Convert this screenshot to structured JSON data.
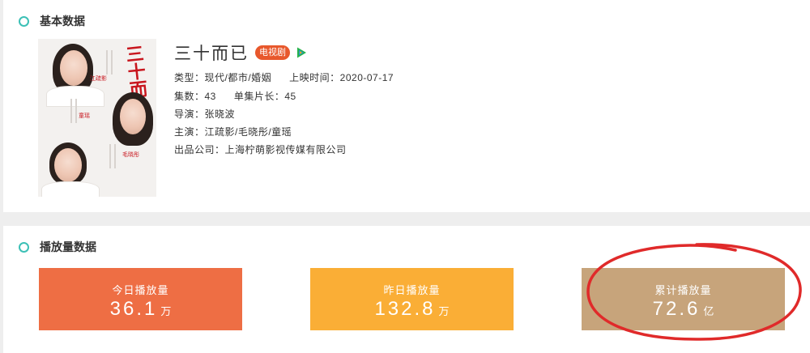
{
  "basic": {
    "section_title": "基本数据",
    "title": "三十而已",
    "badge": "电视剧",
    "genre": "类型：现代/都市/婚姻",
    "release": "上映时间：2020-07-17",
    "episodes": "集数：43",
    "duration": "单集片长：45",
    "director": "导演：张晓波",
    "cast": "主演：江疏影/毛晓彤/童瑶",
    "company": "出品公司：上海柠萌影视传媒有限公司",
    "poster_text": "三十而已",
    "poster_names": [
      "江疏影",
      "童瑶",
      "毛晓彤"
    ]
  },
  "play": {
    "section_title": "播放量数据",
    "stats": [
      {
        "label": "今日播放量",
        "value": "36.1",
        "unit": "万",
        "color": "#ee6e44"
      },
      {
        "label": "昨日播放量",
        "value": "132.8",
        "unit": "万",
        "color": "#faae36"
      },
      {
        "label": "累计播放量",
        "value": "72.6",
        "unit": "亿",
        "color": "#c7a47b"
      }
    ]
  },
  "colors": {
    "accent": "#3cc0b6",
    "badge": "#e8582c",
    "annotation": "#e02a2a"
  },
  "icons": {
    "section": "circle-outline-icon",
    "platform": "play-triangle-icon"
  }
}
